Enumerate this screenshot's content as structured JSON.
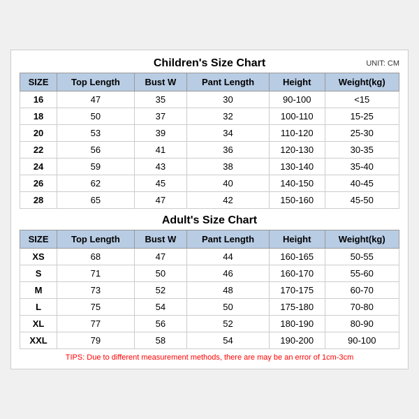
{
  "children_title": "Children's Size Chart",
  "adult_title": "Adult's Size Chart",
  "unit": "UNIT: CM",
  "headers": [
    "SIZE",
    "Top Length",
    "Bust W",
    "Pant Length",
    "Height",
    "Weight(kg)"
  ],
  "children_rows": [
    [
      "16",
      "47",
      "35",
      "30",
      "90-100",
      "<15"
    ],
    [
      "18",
      "50",
      "37",
      "32",
      "100-110",
      "15-25"
    ],
    [
      "20",
      "53",
      "39",
      "34",
      "110-120",
      "25-30"
    ],
    [
      "22",
      "56",
      "41",
      "36",
      "120-130",
      "30-35"
    ],
    [
      "24",
      "59",
      "43",
      "38",
      "130-140",
      "35-40"
    ],
    [
      "26",
      "62",
      "45",
      "40",
      "140-150",
      "40-45"
    ],
    [
      "28",
      "65",
      "47",
      "42",
      "150-160",
      "45-50"
    ]
  ],
  "adult_rows": [
    [
      "XS",
      "68",
      "47",
      "44",
      "160-165",
      "50-55"
    ],
    [
      "S",
      "71",
      "50",
      "46",
      "160-170",
      "55-60"
    ],
    [
      "M",
      "73",
      "52",
      "48",
      "170-175",
      "60-70"
    ],
    [
      "L",
      "75",
      "54",
      "50",
      "175-180",
      "70-80"
    ],
    [
      "XL",
      "77",
      "56",
      "52",
      "180-190",
      "80-90"
    ],
    [
      "XXL",
      "79",
      "58",
      "54",
      "190-200",
      "90-100"
    ]
  ],
  "tips": "TIPS: Due to different measurement methods, there are may be an error of 1cm-3cm"
}
